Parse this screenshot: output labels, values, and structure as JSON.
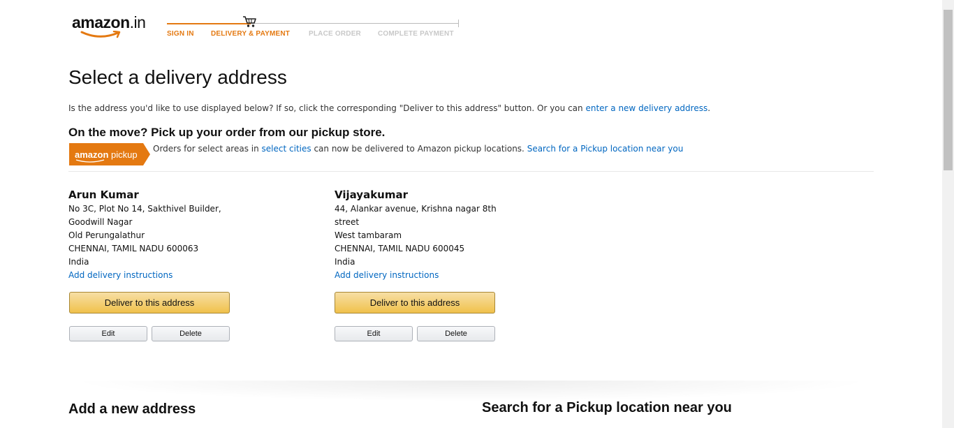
{
  "header": {
    "logo_text": "amazon",
    "logo_tld": ".in",
    "steps": [
      {
        "label": "SIGN IN",
        "state": "done"
      },
      {
        "label": "DELIVERY & PAYMENT",
        "state": "done"
      },
      {
        "label": "PLACE ORDER",
        "state": "todo"
      },
      {
        "label": "COMPLETE PAYMENT",
        "state": "todo"
      }
    ]
  },
  "main": {
    "title": "Select a delivery address",
    "intro_text": "Is the address you'd like to use displayed below? If so, click the corresponding \"Deliver to this address\" button. Or you can",
    "intro_link": "enter a new delivery address",
    "intro_end": ".",
    "pickup": {
      "title": "On the move? Pick up your order from our pickup store.",
      "badge_brand": "amazon",
      "badge_word": "pickup",
      "text_before": "Orders for select areas in",
      "link_cities": "select cities",
      "text_after": "can now be delivered to Amazon pickup locations.",
      "link_search": "Search for a Pickup location near you"
    },
    "addresses": [
      {
        "name": "Arun Kumar",
        "lines": [
          "No 3C, Plot No 14, Sakthivel Builder,",
          "Goodwill Nagar",
          "Old Perungalathur",
          "CHENNAI, TAMIL NADU 600063",
          "India"
        ],
        "instructions_link": "Add delivery instructions",
        "deliver_label": "Deliver to this address",
        "edit_label": "Edit",
        "delete_label": "Delete"
      },
      {
        "name": "Vijayakumar",
        "lines": [
          "44, Alankar avenue, Krishna nagar 8th",
          "street",
          "West tambaram",
          "CHENNAI, TAMIL NADU 600045",
          "India"
        ],
        "instructions_link": "Add delivery instructions",
        "deliver_label": "Deliver to this address",
        "edit_label": "Edit",
        "delete_label": "Delete"
      }
    ],
    "add_new_title": "Add a new address",
    "pickup_search_title": "Search for a Pickup location near you"
  },
  "colors": {
    "accent": "#e47911",
    "link": "#0066c0",
    "button_primary": "#f0c14b"
  }
}
